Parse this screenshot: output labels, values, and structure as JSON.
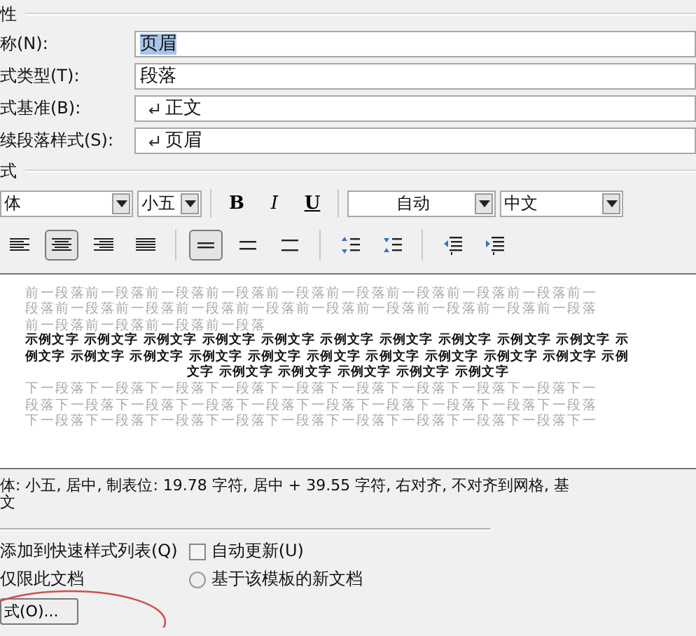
{
  "properties": {
    "title": "性",
    "fields": [
      {
        "label": "称(N):",
        "value": "页眉",
        "kind": "plain",
        "selected": true
      },
      {
        "label": "式类型(T):",
        "value": "段落",
        "kind": "plain",
        "selected": false
      },
      {
        "label": "式基准(B):",
        "value": "正文",
        "kind": "style",
        "selected": false
      },
      {
        "label": "续段落样式(S):",
        "value": "页眉",
        "kind": "style",
        "selected": false
      }
    ]
  },
  "format": {
    "title": "式",
    "font": "体",
    "size": "小五",
    "bold": "B",
    "italic": "I",
    "underline": "U",
    "font_color_choice": "自动",
    "script": "中文"
  },
  "paragraph_buttons": [
    {
      "kind": "align-left",
      "selected": false
    },
    {
      "kind": "align-center",
      "selected": true
    },
    {
      "kind": "align-right",
      "selected": false
    },
    {
      "kind": "justify",
      "selected": false
    },
    {
      "kind": "single-spacing",
      "selected": true
    },
    {
      "kind": "one-half-spacing",
      "selected": false
    },
    {
      "kind": "double-spacing",
      "selected": false
    },
    {
      "kind": "space-before",
      "selected": false
    },
    {
      "kind": "space-after",
      "selected": false
    },
    {
      "kind": "decrease-indent",
      "selected": false
    },
    {
      "kind": "increase-indent",
      "selected": false
    }
  ],
  "preview": {
    "previous": [
      "前一段落前一段落前一段落前一段落前一段落前一段落前一段落前一段落前一段落前一",
      "段落前一段落前一段落前一段落前一段落前一段落前一段落前一段落前一段落前一段落",
      "前一段落前一段落前一段落前一段落"
    ],
    "sample": [
      "示例文字 示例文字 示例文字 示例文字 示例文字 示例文字 示例文字 示例文字 示例文字 示例文字 示",
      "例文字 示例文字 示例文字 示例文字 示例文字 示例文字 示例文字 示例文字 示例文字 示例文字 示例",
      "文字 示例文字 示例文字 示例文字 示例文字 示例文字"
    ],
    "next": [
      "下一段落下一段落下一段落下一段落下一段落下一段落下一段落下一段落下一段落下一",
      "段落下一段落下一段落下一段落下一段落下一段落下一段落下一段落下一段落下一段落",
      "下一段落下一段落下一段落下一段落下一段落下一段落下一段落下一段落下一段落下一"
    ]
  },
  "description": [
    "体: 小五, 居中, 制表位:  19.78 字符, 居中 +  39.55 字符, 右对齐, 不对齐到网格, 基",
    "文"
  ],
  "options": [
    {
      "kind": "label",
      "label": "添加到快速样式列表(Q)"
    },
    {
      "kind": "checkbox",
      "label": "自动更新(U)",
      "checked": false
    },
    {
      "kind": "label",
      "label": "仅限此文档"
    },
    {
      "kind": "radio",
      "label": "基于该模板的新文档",
      "selected": false
    }
  ],
  "format_button": "式(O)..."
}
